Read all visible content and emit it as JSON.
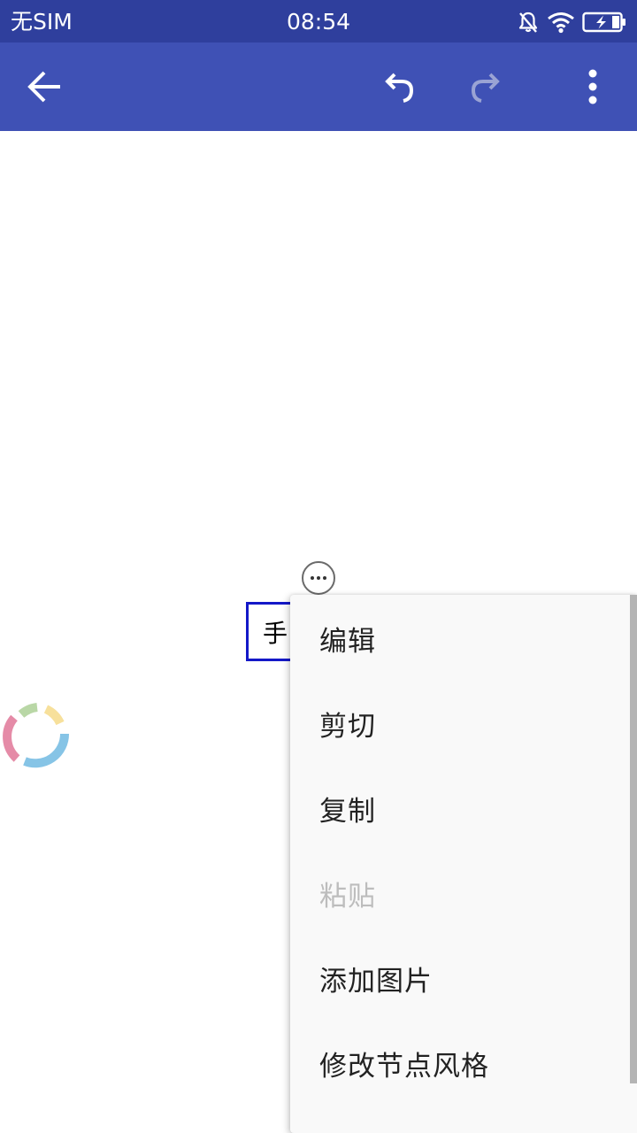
{
  "status_bar": {
    "carrier": "无SIM",
    "time": "08:54",
    "icons": [
      "mute-bell-icon",
      "wifi-icon",
      "battery-charging-icon"
    ]
  },
  "toolbar": {
    "back_icon": "arrow-left-icon",
    "undo_icon": "undo-icon",
    "redo_icon": "redo-icon",
    "redo_enabled": false,
    "more_icon": "more-vertical-icon",
    "background_color": "#3f51b5",
    "status_bar_color": "#2f3f9d"
  },
  "canvas": {
    "root_node_text": "手",
    "root_node_border_color": "#1418c8",
    "node_more_icon": "more-horizontal-icon",
    "loading_icon": "spinner-icon"
  },
  "context_menu": {
    "items": [
      {
        "label": "编辑",
        "enabled": true
      },
      {
        "label": "剪切",
        "enabled": true
      },
      {
        "label": "复制",
        "enabled": true
      },
      {
        "label": "粘贴",
        "enabled": false
      },
      {
        "label": "添加图片",
        "enabled": true
      },
      {
        "label": "修改节点风格",
        "enabled": true
      }
    ]
  }
}
